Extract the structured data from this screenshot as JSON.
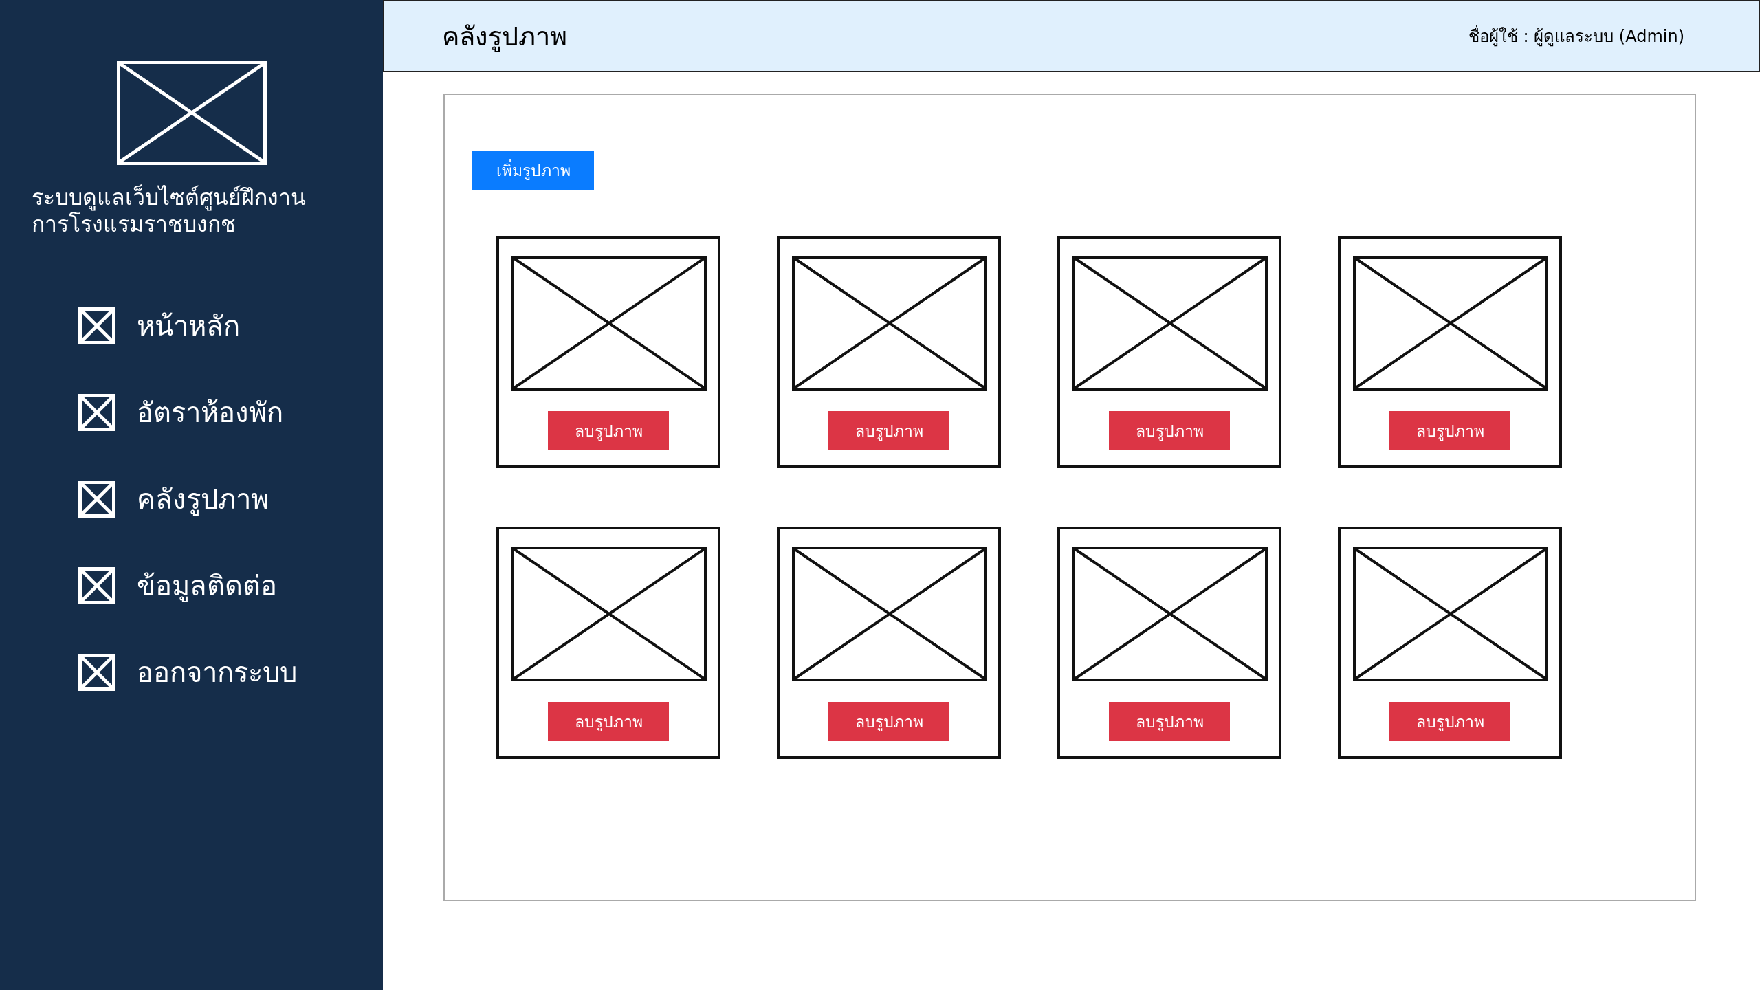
{
  "sidebar": {
    "title": "ระบบดูแลเว็บไซต์ศูนย์ฝึกงานการโรงแรมราชบงกช",
    "items": [
      {
        "label": "หน้าหลัก"
      },
      {
        "label": "อัตราห้องพัก"
      },
      {
        "label": "คลังรูปภาพ"
      },
      {
        "label": "ข้อมูลติดต่อ"
      },
      {
        "label": "ออกจากระบบ"
      }
    ]
  },
  "header": {
    "title": "คลังรูปภาพ",
    "user": "ชื่อผู้ใช้ : ผู้ดูแลระบบ (Admin)"
  },
  "add_button": "เพิ่มรูปภาพ",
  "images": [
    {
      "delete_button": "ลบรูปภาพ"
    },
    {
      "delete_button": "ลบรูปภาพ"
    },
    {
      "delete_button": "ลบรูปภาพ"
    },
    {
      "delete_button": "ลบรูปภาพ"
    },
    {
      "delete_button": "ลบรูปภาพ"
    },
    {
      "delete_button": "ลบรูปภาพ"
    },
    {
      "delete_button": "ลบรูปภาพ"
    },
    {
      "delete_button": "ลบรูปภาพ"
    }
  ]
}
